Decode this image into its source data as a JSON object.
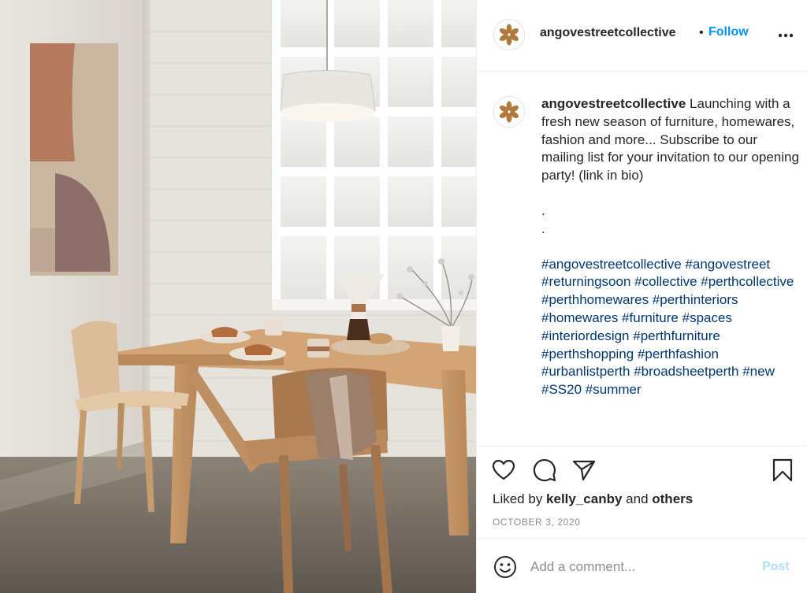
{
  "post_image": {
    "alt_semantic": "dining-room-photo"
  },
  "header": {
    "username": "angovestreetcollective",
    "separator": "•",
    "follow_label": "Follow",
    "more_icon": "more-horizontal-icon"
  },
  "caption": {
    "username": "angovestreetcollective",
    "text": " Launching with a fresh new season of furniture, homewares, fashion and more... Subscribe to our mailing list for your invitation to our opening party! (link in bio)",
    "dots": [
      ".",
      "."
    ],
    "hashtags": [
      "#angovestreetcollective",
      "#angovestreet",
      "#returningsoon",
      "#collective",
      "#perthcollective",
      "#perthhomewares",
      "#perthinteriors",
      "#homewares",
      "#furniture",
      "#spaces",
      "#interiordesign",
      "#perthfurniture",
      "#perthshopping",
      "#perthfashion",
      "#urbanlistperth",
      "#broadsheetperth",
      "#new",
      "#SS20",
      "#summer"
    ]
  },
  "actions": {
    "icons": [
      "heart-icon",
      "comment-icon",
      "share-icon",
      "bookmark-icon"
    ],
    "likes_prefix": "Liked by ",
    "likes_user": "kelly_canby",
    "likes_and": " and ",
    "likes_others": "others",
    "date": "OCTOBER 3, 2020"
  },
  "comment": {
    "placeholder": "Add a comment...",
    "post_label": "Post",
    "emoji_icon": "smiley-icon"
  },
  "colors": {
    "accent_blue": "#0095f6",
    "hashtag_blue": "#00376b",
    "post_disabled": "#b2dffc",
    "logo_brown": "#b07a3f"
  }
}
